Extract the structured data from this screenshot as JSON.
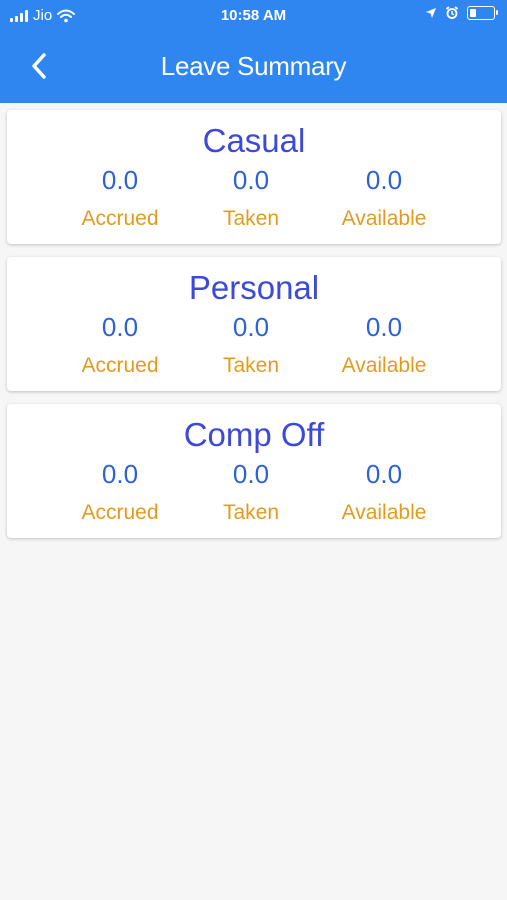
{
  "status_bar": {
    "carrier": "Jio",
    "time": "10:58 AM",
    "battery_level": 0.3
  },
  "nav": {
    "title": "Leave Summary",
    "back_icon": "chevron-left-icon"
  },
  "colors": {
    "header_bg": "#2f86f0",
    "title": "#3d4ad8",
    "value": "#2d62d6",
    "label": "#e39b1d"
  },
  "leave_types": [
    {
      "name": "Casual",
      "accrued": "0.0",
      "taken": "0.0",
      "available": "0.0"
    },
    {
      "name": "Personal",
      "accrued": "0.0",
      "taken": "0.0",
      "available": "0.0"
    },
    {
      "name": "Comp Off",
      "accrued": "0.0",
      "taken": "0.0",
      "available": "0.0"
    }
  ],
  "labels": {
    "accrued": "Accrued",
    "taken": "Taken",
    "available": "Available"
  }
}
